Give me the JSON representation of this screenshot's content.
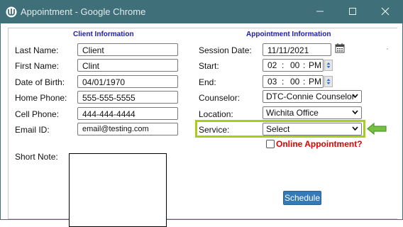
{
  "window": {
    "title": "Appointment - Google Chrome"
  },
  "client_info": {
    "heading": "Client Information",
    "last_name_label": "Last Name:",
    "last_name_value": "Client",
    "first_name_label": "First Name:",
    "first_name_value": "Clint",
    "dob_label": "Date of Birth:",
    "dob_value": "04/01/1970",
    "home_phone_label": "Home Phone:",
    "home_phone_value": "555-555-5555",
    "cell_phone_label": "Cell Phone:",
    "cell_phone_value": "444-444-4444",
    "email_label": "Email ID:",
    "email_value": "email@testing.com",
    "short_note_label": "Short Note:"
  },
  "appointment_info": {
    "heading": "Appointment Information",
    "session_date_label": "Session Date:",
    "session_date_value": "11/11/2021",
    "start_label": "Start:",
    "start_hour": "02",
    "start_minute": "00",
    "start_ampm": "PM",
    "end_label": "End:",
    "end_hour": "03",
    "end_minute": "00",
    "end_ampm": "PM",
    "time_sep": ":",
    "counselor_label": "Counselor:",
    "counselor_value": "DTC-Connie Counselor",
    "location_label": "Location:",
    "location_value": "Wichita Office",
    "service_label": "Service:",
    "service_value": "Select",
    "online_label": "Online Appointment?",
    "online_checked": false,
    "schedule_button": "Schedule"
  },
  "colors": {
    "titlebar": "#3f6f79",
    "section_heading": "#1c1ca8",
    "highlight_box": "#a7cd1f",
    "arrow": "#76c043",
    "online_label": "#e00000",
    "schedule_button": "#357ab8"
  },
  "icons": [
    "app-icon",
    "minimize-icon",
    "maximize-icon",
    "close-icon",
    "calendar-icon",
    "chevron-down-icon",
    "spinner-icon",
    "arrow-left-icon"
  ]
}
